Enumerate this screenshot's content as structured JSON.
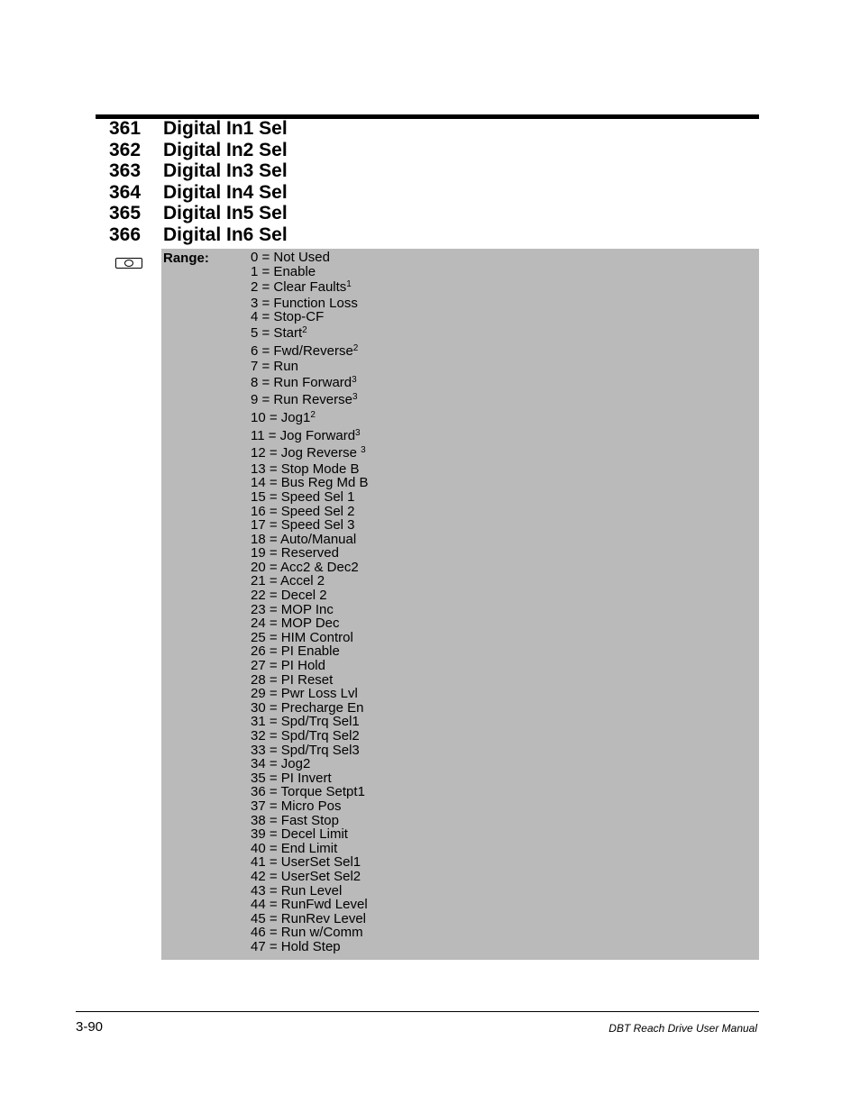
{
  "parameters": [
    {
      "number": "361",
      "name": "Digital In1 Sel"
    },
    {
      "number": "362",
      "name": "Digital In2 Sel"
    },
    {
      "number": "363",
      "name": "Digital In3 Sel"
    },
    {
      "number": "364",
      "name": "Digital In4 Sel"
    },
    {
      "number": "365",
      "name": "Digital In5 Sel"
    },
    {
      "number": "366",
      "name": "Digital In6 Sel"
    }
  ],
  "access_icon": "camera-icon",
  "range": {
    "label": "Range:",
    "options": [
      {
        "text": "0 = Not Used",
        "sup": ""
      },
      {
        "text": "1 = Enable",
        "sup": ""
      },
      {
        "text": "2 = Clear Faults",
        "sup": "1"
      },
      {
        "text": "3 = Function Loss",
        "sup": ""
      },
      {
        "text": "4 = Stop-CF",
        "sup": ""
      },
      {
        "text": "5 = Start",
        "sup": "2"
      },
      {
        "text": "6 = Fwd/Reverse",
        "sup": "2"
      },
      {
        "text": "7 = Run",
        "sup": ""
      },
      {
        "text": "8 = Run Forward",
        "sup": "3"
      },
      {
        "text": "9 = Run Reverse",
        "sup": "3"
      },
      {
        "text": "10 = Jog1",
        "sup": "2"
      },
      {
        "text": "11 = Jog Forward",
        "sup": "3"
      },
      {
        "text": "12 = Jog Reverse ",
        "sup": "3"
      },
      {
        "text": "13 = Stop Mode B",
        "sup": ""
      },
      {
        "text": "14 = Bus Reg Md B",
        "sup": ""
      },
      {
        "text": "15 = Speed Sel 1",
        "sup": ""
      },
      {
        "text": "16 = Speed Sel 2",
        "sup": ""
      },
      {
        "text": "17 = Speed Sel 3",
        "sup": ""
      },
      {
        "text": "18 = Auto/Manual",
        "sup": ""
      },
      {
        "text": "19 = Reserved",
        "sup": ""
      },
      {
        "text": "20 = Acc2 & Dec2",
        "sup": ""
      },
      {
        "text": "21 = Accel 2",
        "sup": ""
      },
      {
        "text": "22 = Decel 2",
        "sup": ""
      },
      {
        "text": "23 = MOP Inc",
        "sup": ""
      },
      {
        "text": "24 = MOP Dec",
        "sup": ""
      },
      {
        "text": "25 = HIM Control",
        "sup": ""
      },
      {
        "text": "26 = PI Enable",
        "sup": ""
      },
      {
        "text": "27 = PI Hold",
        "sup": ""
      },
      {
        "text": "28 = PI Reset",
        "sup": ""
      },
      {
        "text": "29 = Pwr Loss Lvl",
        "sup": ""
      },
      {
        "text": "30 = Precharge En",
        "sup": ""
      },
      {
        "text": "31 = Spd/Trq Sel1",
        "sup": ""
      },
      {
        "text": "32 = Spd/Trq Sel2",
        "sup": ""
      },
      {
        "text": "33 = Spd/Trq Sel3",
        "sup": ""
      },
      {
        "text": "34 = Jog2",
        "sup": ""
      },
      {
        "text": "35 = PI Invert",
        "sup": ""
      },
      {
        "text": "36 = Torque Setpt1",
        "sup": ""
      },
      {
        "text": "37 = Micro Pos",
        "sup": ""
      },
      {
        "text": "38 = Fast Stop",
        "sup": ""
      },
      {
        "text": "39 = Decel Limit",
        "sup": ""
      },
      {
        "text": "40 = End Limit",
        "sup": ""
      },
      {
        "text": "41 = UserSet Sel1",
        "sup": ""
      },
      {
        "text": "42 = UserSet Sel2",
        "sup": ""
      },
      {
        "text": "43 = Run Level",
        "sup": ""
      },
      {
        "text": "44 = RunFwd Level",
        "sup": ""
      },
      {
        "text": "45 = RunRev Level",
        "sup": ""
      },
      {
        "text": "46 = Run w/Comm",
        "sup": ""
      },
      {
        "text": "47 = Hold Step",
        "sup": ""
      }
    ]
  },
  "footer": {
    "page_number": "3-90",
    "manual_title": "DBT Reach Drive User Manual"
  },
  "colors": {
    "range_background": "#bababa",
    "rule": "#000000"
  }
}
